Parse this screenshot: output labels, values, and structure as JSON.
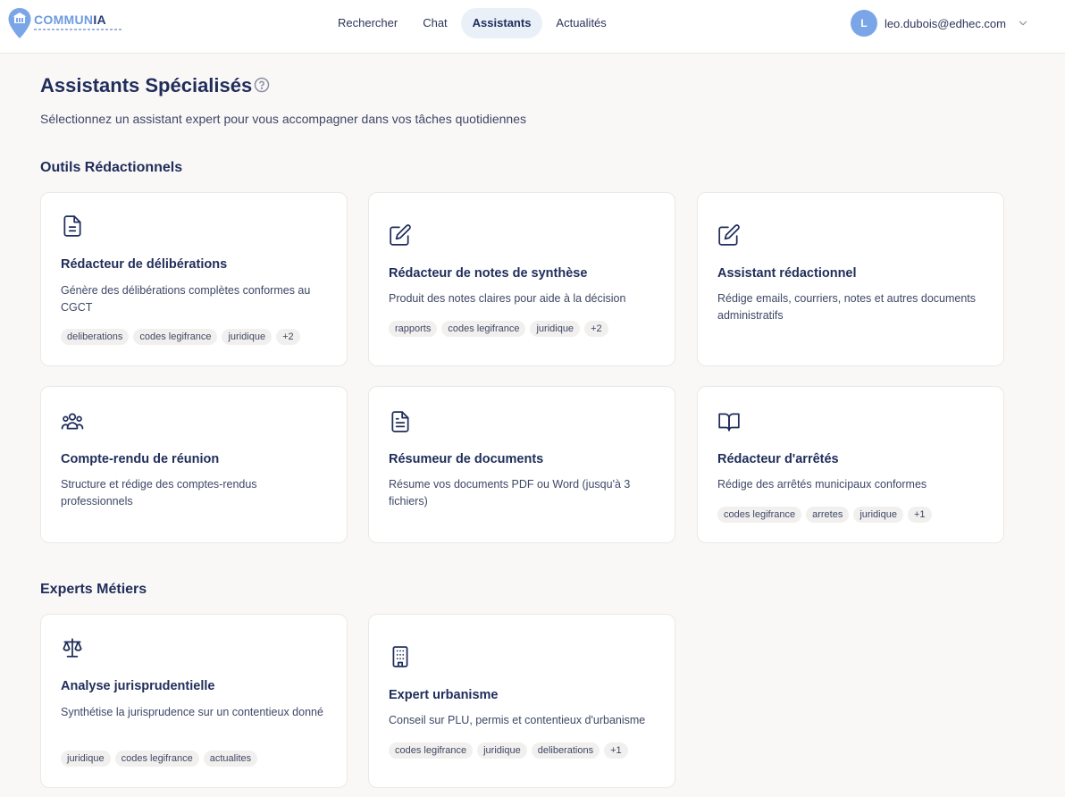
{
  "brand": {
    "name_prefix": "COMMUN",
    "name_suffix": "IA"
  },
  "nav": {
    "tabs": [
      {
        "label": "Rechercher",
        "active": false
      },
      {
        "label": "Chat",
        "active": false
      },
      {
        "label": "Assistants",
        "active": true
      },
      {
        "label": "Actualités",
        "active": false
      }
    ]
  },
  "user": {
    "initial": "L",
    "email": "leo.dubois@edhec.com"
  },
  "page": {
    "title": "Assistants Spécialisés",
    "subtitle": "Sélectionnez un assistant expert pour vous accompagner dans vos tâches quotidiennes"
  },
  "sections": [
    {
      "title": "Outils Rédactionnels",
      "cards": [
        {
          "icon": "document-icon",
          "title": "Rédacteur de délibérations",
          "description": "Génère des délibérations complètes conformes au CGCT",
          "tags": [
            "deliberations",
            "codes legifrance",
            "juridique",
            "+2"
          ]
        },
        {
          "icon": "edit-icon",
          "title": "Rédacteur de notes de synthèse",
          "description": "Produit des notes claires pour aide à la décision",
          "tags": [
            "rapports",
            "codes legifrance",
            "juridique",
            "+2"
          ]
        },
        {
          "icon": "edit-icon",
          "title": "Assistant rédactionnel",
          "description": "Rédige emails, courriers, notes et autres documents administratifs",
          "tags": []
        },
        {
          "icon": "users-icon",
          "title": "Compte-rendu de réunion",
          "description": "Structure et rédige des comptes-rendus professionnels",
          "tags": []
        },
        {
          "icon": "file-text-icon",
          "title": "Résumeur de documents",
          "description": "Résume vos documents PDF ou Word (jusqu'à 3 fichiers)",
          "tags": []
        },
        {
          "icon": "book-open-icon",
          "title": "Rédacteur d'arrêtés",
          "description": "Rédige des arrêtés municipaux conformes",
          "tags": [
            "codes legifrance",
            "arretes",
            "juridique",
            "+1"
          ]
        }
      ]
    },
    {
      "title": "Experts Métiers",
      "cards": [
        {
          "icon": "scale-icon",
          "title": "Analyse jurisprudentielle",
          "description": "Synthétise la jurisprudence sur un contentieux donné",
          "tags": [
            "juridique",
            "codes legifrance",
            "actualites"
          ]
        },
        {
          "icon": "building-icon",
          "title": "Expert urbanisme",
          "description": "Conseil sur PLU, permis et contentieux d'urbanisme",
          "tags": [
            "codes legifrance",
            "juridique",
            "deliberations",
            "+1"
          ]
        }
      ]
    }
  ],
  "colors": {
    "accent": "#7aa6e8",
    "title": "#1f2d5a",
    "active_tab_bg": "#eaf0f8",
    "tag_bg": "#f2f0ee"
  }
}
